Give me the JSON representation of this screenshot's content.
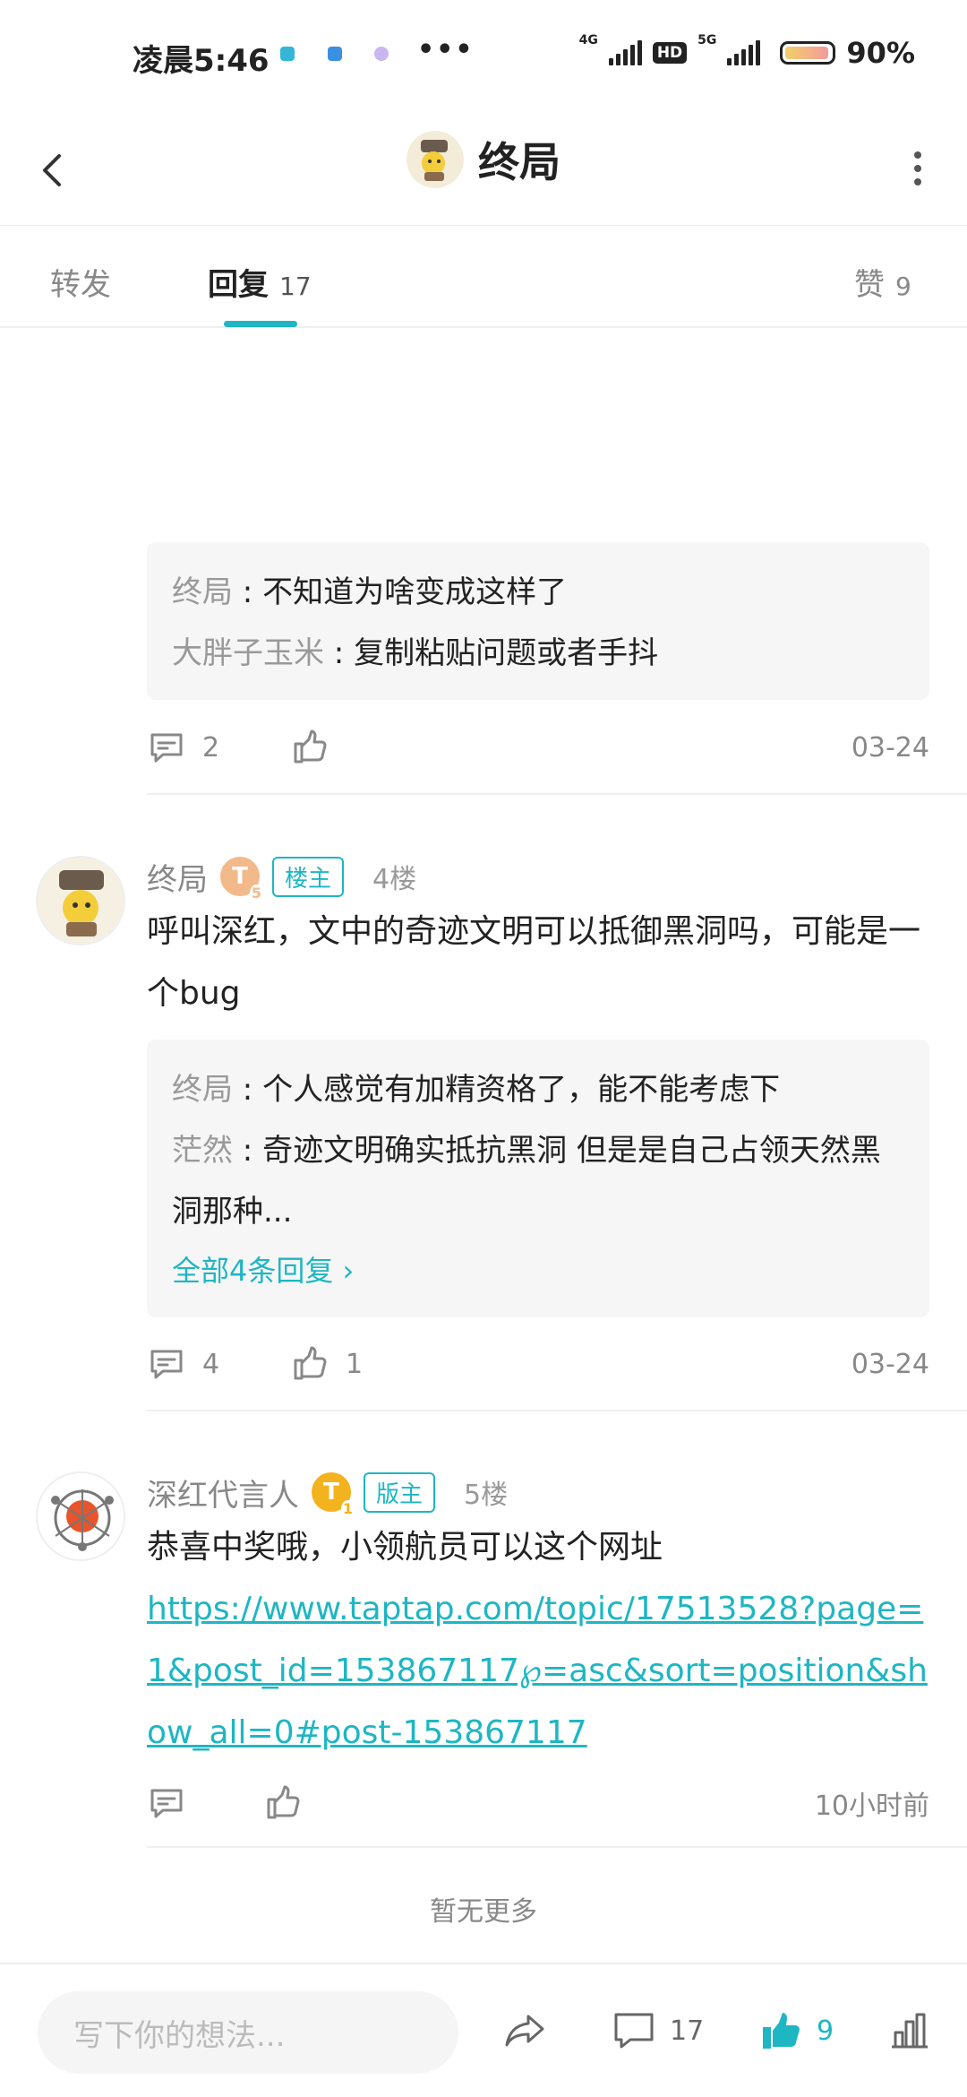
{
  "status_bar": {
    "time": "凌晨5:46",
    "more": "•••",
    "net1": "4G",
    "net2": "5G",
    "hd": "HD",
    "battery": "90%"
  },
  "header": {
    "title": "终局"
  },
  "tabs": [
    {
      "label": "转发",
      "count": ""
    },
    {
      "label": "回复",
      "count": "17"
    },
    {
      "label": "赞",
      "count": "9"
    }
  ],
  "post3": {
    "quotes": [
      {
        "name": "终局",
        "text": "不知道为啥变成这样了"
      },
      {
        "name": "大胖子玉米",
        "text": "复制粘贴问题或者手抖"
      }
    ],
    "comments": "2",
    "likes": "",
    "date": "03-24"
  },
  "post4": {
    "user": "终局",
    "level": "T",
    "level_sub": "5",
    "badge": "楼主",
    "floor": "4楼",
    "text": "呼叫深红，文中的奇迹文明可以抵御黑洞吗，可能是一个bug",
    "quotes": [
      {
        "name": "终局",
        "text": "个人感觉有加精资格了，能不能考虑下"
      },
      {
        "name": "茫然",
        "text": "奇迹文明确实抵抗黑洞 但是是自己占领天然黑洞那种..."
      }
    ],
    "more_replies": "全部4条回复",
    "comments": "4",
    "likes": "1",
    "date": "03-24"
  },
  "post5": {
    "user": "深红代言人",
    "level": "T",
    "level_sub": "1",
    "badge": "版主",
    "floor": "5楼",
    "text": "恭喜中奖哦，小领航员可以这个网址",
    "link": "https://www.taptap.com/topic/17513528?page=1&post_id=153867117℘=asc&sort=position&show_all=0#post-153867117",
    "comments": "",
    "likes": "",
    "date": "10小时前"
  },
  "footer": {
    "no_more": "暂无更多"
  },
  "bottom_bar": {
    "placeholder": "写下你的想法...",
    "comment_count": "17",
    "like_count": "9",
    "accent": "#1eb6c3"
  }
}
